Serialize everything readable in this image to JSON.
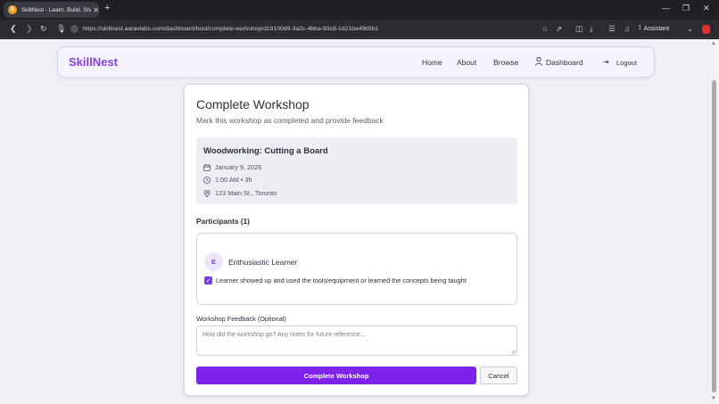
{
  "browser": {
    "tab_title": "SkillNest - Learn. Build. Share.",
    "favicon_letter": "S",
    "url": "https://skillnest.aaravlabs.com/dashboard/host/complete-workshop/d19100d9-3a2c-4bba-93c8-1d21ba49b5b1",
    "assistant_label": "Assistant"
  },
  "navbar": {
    "brand": "SkillNest",
    "links": [
      "Home",
      "About",
      "Browse"
    ],
    "dashboard": "Dashboard",
    "logout": "Logout"
  },
  "page": {
    "title": "Complete Workshop",
    "subtitle": "Mark this workshop as completed and provide feedback"
  },
  "workshop": {
    "title": "Woodworking: Cutting a Board",
    "date": "January 9, 2025",
    "time": "1:00 AM • 3h",
    "location": "123 Main St., Toronto"
  },
  "participants": {
    "heading": "Participants (1)",
    "items": [
      {
        "initial": "E",
        "name": "Enthusiastic Learner",
        "checked": true,
        "checkbox_label": "Learner showed up and used the tools/equipment or learned the concepts being taught"
      }
    ]
  },
  "feedback": {
    "label": "Workshop Feedback (Optional)",
    "placeholder": "How did the workshop go? Any notes for future reference...",
    "value": ""
  },
  "actions": {
    "complete": "Complete Workshop",
    "cancel": "Cancel"
  },
  "colors": {
    "accent": "#7c22ea",
    "brand": "#8a3ee0"
  }
}
